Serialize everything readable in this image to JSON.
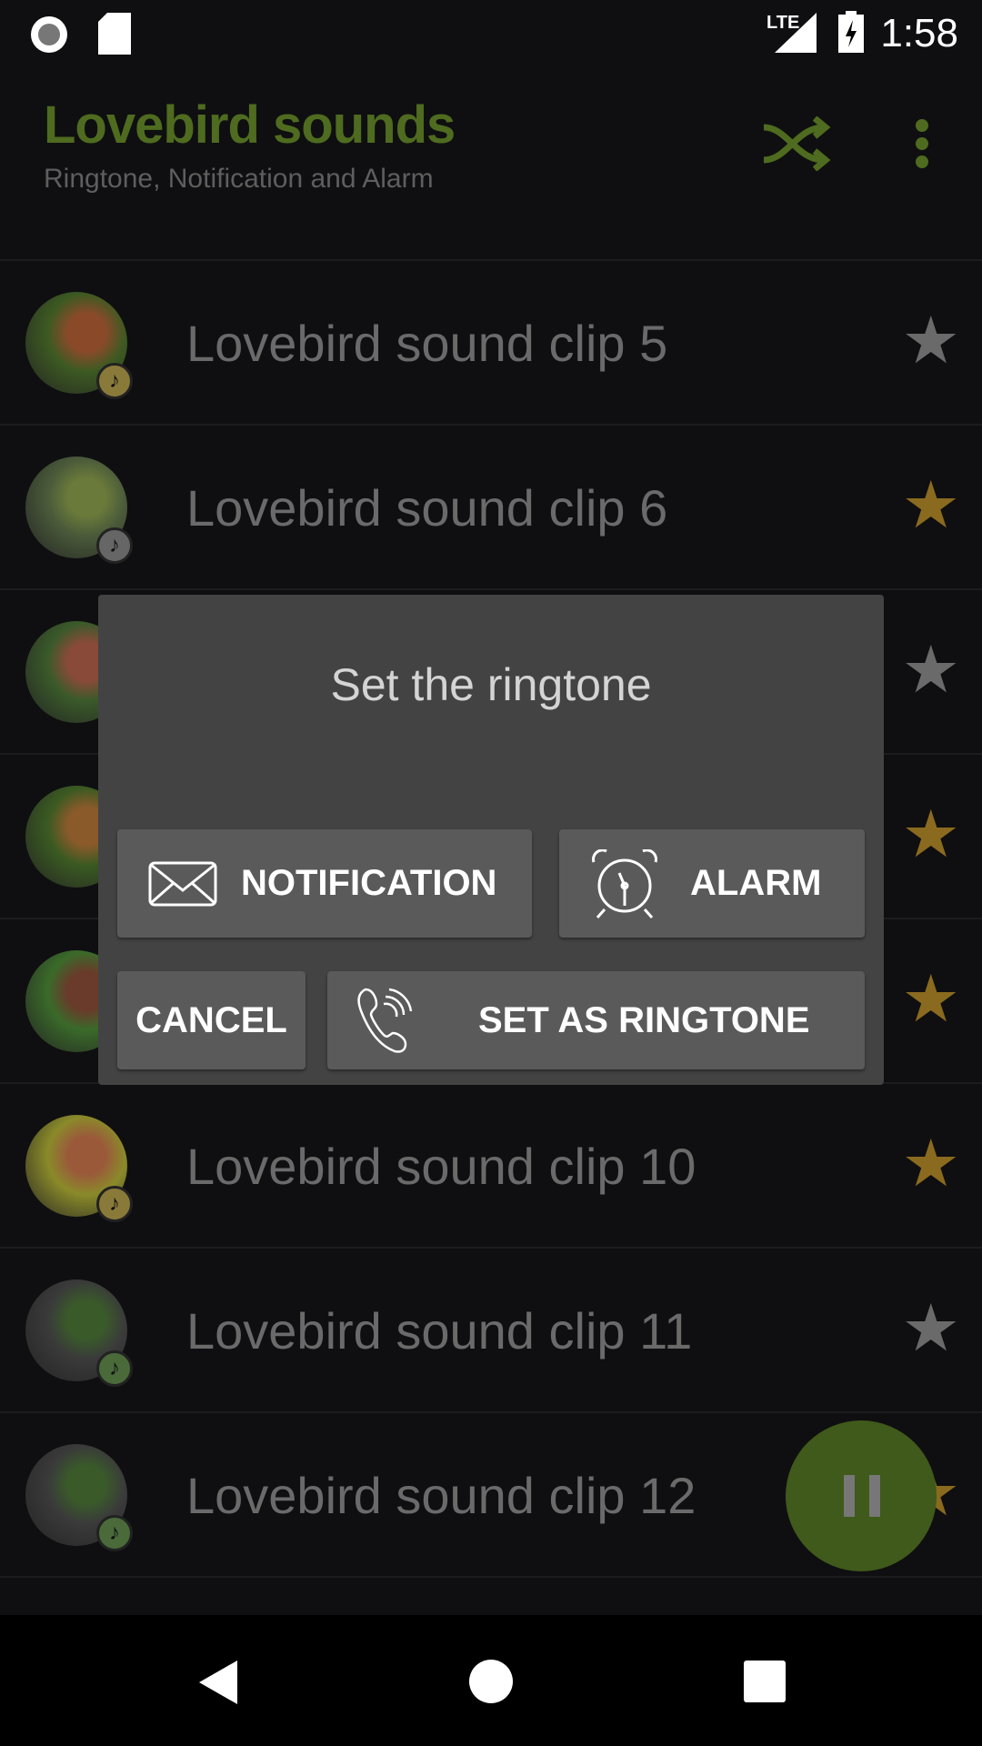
{
  "status_bar": {
    "time": "1:58",
    "network": "LTE",
    "icons": [
      "record-icon",
      "sd-card-icon",
      "signal-icon",
      "battery-charging-icon"
    ]
  },
  "toolbar": {
    "title": "Lovebird sounds",
    "subtitle": "Ringtone, Notification and Alarm",
    "icons": [
      "shuffle-icon",
      "more-vert-icon"
    ]
  },
  "list": [
    {
      "label": "Lovebird sound clip 5",
      "favorite": false,
      "badge_color": "#8a7a3a"
    },
    {
      "label": "Lovebird sound clip 6",
      "favorite": true,
      "badge_color": "#666666"
    },
    {
      "label": "",
      "favorite": false
    },
    {
      "label": "",
      "favorite": true
    },
    {
      "label": "",
      "favorite": true
    },
    {
      "label": "Lovebird sound clip 10",
      "favorite": true,
      "badge_color": "#8a7a3a"
    },
    {
      "label": "Lovebird sound clip 11",
      "favorite": false,
      "badge_color": "#4a6a3a"
    },
    {
      "label": "Lovebird sound clip 12",
      "favorite": true,
      "badge_color": "#4a6a3a"
    }
  ],
  "dialog": {
    "title": "Set the ringtone",
    "notification": "NOTIFICATION",
    "alarm": "ALARM",
    "cancel": "CANCEL",
    "set_ringtone": "SET AS RINGTONE"
  },
  "colors": {
    "accent": "#4e6b1f",
    "star_on": "#8a6a1e",
    "star_off": "#6a6a6a"
  }
}
